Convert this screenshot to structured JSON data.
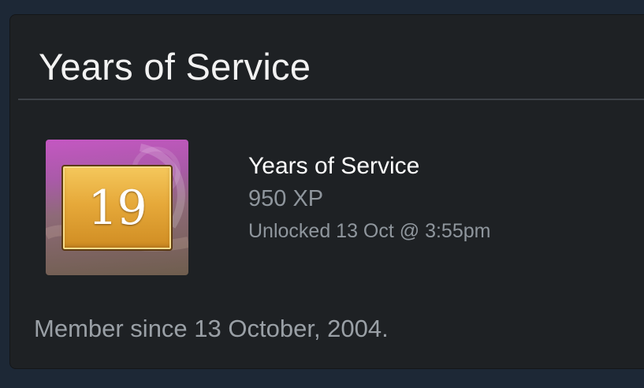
{
  "card": {
    "title": "Years of Service"
  },
  "achievement": {
    "icon": "years-of-service-badge",
    "badge_number": "19",
    "name": "Years of Service",
    "xp": "950 XP",
    "unlocked": "Unlocked 13 Oct @ 3:55pm"
  },
  "member_since": "Member since 13 October, 2004.",
  "colors": {
    "page_background": "#1d2836",
    "card_background": "#1e2124",
    "title_text": "#f2f2f2",
    "secondary_text": "#8f969d",
    "badge_gold": "#e6a93a",
    "badge_purple": "#c457c2"
  }
}
